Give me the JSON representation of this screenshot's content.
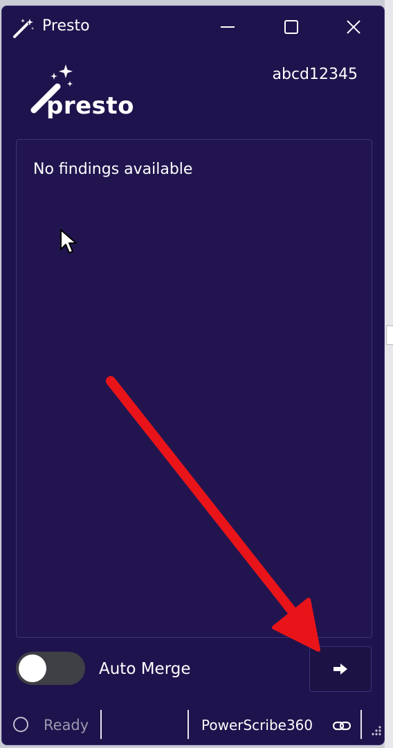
{
  "window": {
    "title": "Presto",
    "controls": {
      "minimize_icon": "minimize-icon",
      "maximize_icon": "maximize-icon",
      "close_icon": "close-icon"
    }
  },
  "brand": {
    "logo_word": "presto",
    "icon": "magic-wand-icon"
  },
  "user": {
    "id": "abcd12345"
  },
  "findings": {
    "empty_message": "No findings available"
  },
  "auto_merge": {
    "label": "Auto Merge",
    "enabled": false
  },
  "send_button": {
    "icon": "arrow-right-icon"
  },
  "status": {
    "text": "Ready",
    "indicator_icon": "status-circle-icon",
    "integration": "PowerScribe360",
    "integration_icon": "link-icon"
  },
  "colors": {
    "background": "#1f134d",
    "panel_border": "#3d3278",
    "text": "#ffffff",
    "muted_text": "#9a9aae",
    "toggle_off": "#3f3f46",
    "annotation": "#e8141a"
  }
}
